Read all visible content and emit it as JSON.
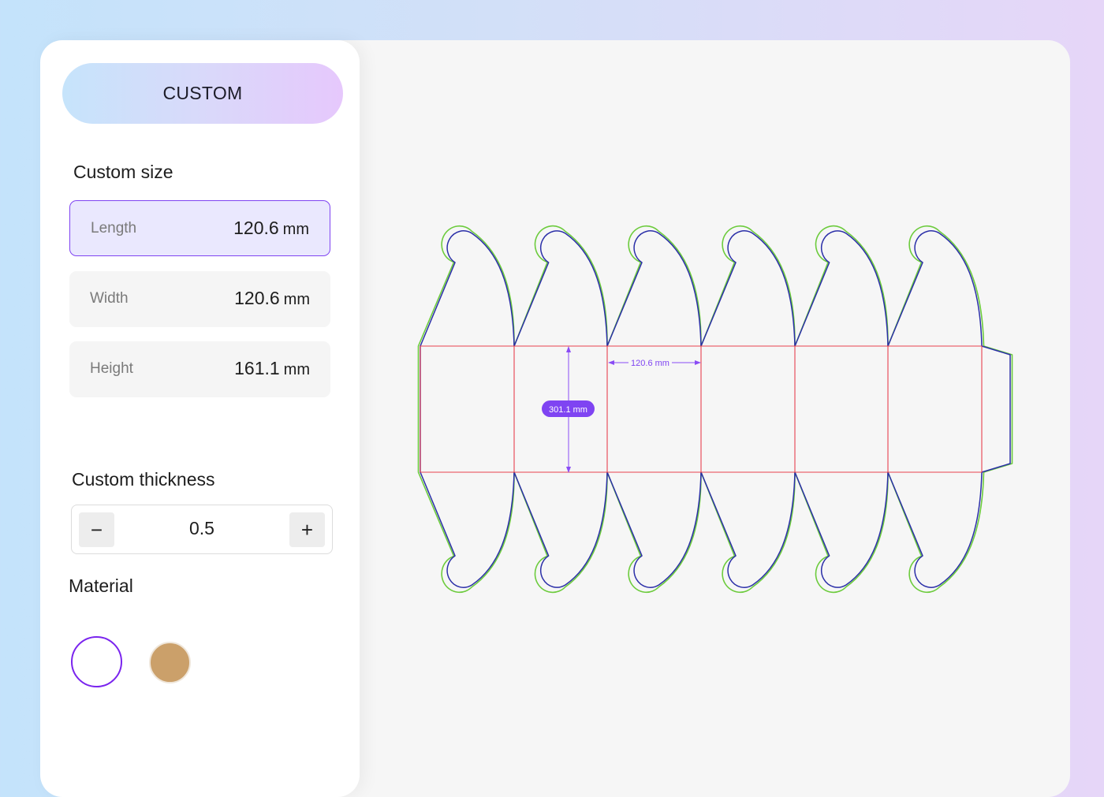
{
  "sidebar": {
    "mode_label": "CUSTOM",
    "size_title": "Custom size",
    "fields": [
      {
        "label": "Length",
        "value": "120.6",
        "unit": "mm"
      },
      {
        "label": "Width",
        "value": "120.6",
        "unit": "mm"
      },
      {
        "label": "Height",
        "value": "161.1",
        "unit": "mm"
      }
    ],
    "thickness_title": "Custom thickness",
    "thickness": {
      "minus": "−",
      "value": "0.5",
      "plus": "+"
    },
    "material_title": "Material",
    "materials": [
      {
        "name": "white",
        "color": "#ffffff",
        "selected": true
      },
      {
        "name": "kraft",
        "color": "#cba06a",
        "selected": false
      }
    ]
  },
  "dieline": {
    "vertical_dim": "301.1 mm",
    "horizontal_dim": "120.6 mm",
    "colors": {
      "cut": "#2b2fa8",
      "bleed": "#6ccb3c",
      "fold": "#e8414f",
      "dim": "#7f44f2"
    }
  }
}
